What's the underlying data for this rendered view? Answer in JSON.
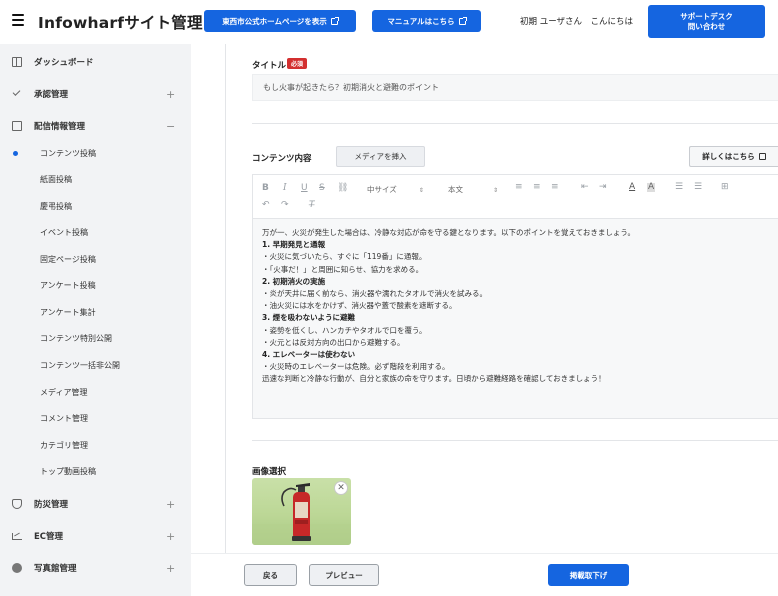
{
  "header": {
    "app_title": "Infowharfサイト管理",
    "city_site_button": "東西市公式ホームページを表示",
    "manual_button": "マニュアルはこちら",
    "greeting": "初期 ユーザさん　こんにちは",
    "support_button_line1": "サポートデスク",
    "support_button_line2": "問い合わせ"
  },
  "sidebar": {
    "items": [
      {
        "label": "ダッシュボード",
        "icon": "dashboard-icon"
      },
      {
        "label": "承認管理",
        "icon": "check-icon",
        "toggle": "+"
      },
      {
        "label": "配信情報管理",
        "icon": "edit-icon",
        "toggle": "−"
      }
    ],
    "subitems": [
      "コンテンツ投稿",
      "紙面投稿",
      "慶弔投稿",
      "イベント投稿",
      "固定ページ投稿",
      "アンケート投稿",
      "アンケート集計",
      "コンテンツ特別公開",
      "コンテンツ一括非公開",
      "メディア管理",
      "コメント管理",
      "カテゴリ管理",
      "トップ動画投稿"
    ],
    "active_subitem": "コンテンツ投稿",
    "bottom_items": [
      {
        "label": "防災管理",
        "icon": "shield-icon",
        "toggle": "+"
      },
      {
        "label": "EC管理",
        "icon": "chart-icon",
        "toggle": "+"
      },
      {
        "label": "写真館管理",
        "icon": "photo-icon",
        "toggle": "+"
      }
    ]
  },
  "form": {
    "title_label": "タイトル",
    "required_badge": "必須",
    "title_value": "もし火事が起きたら？初期消火と避難のポイント",
    "content_label": "コンテンツ内容",
    "insert_media_button": "メディアを挿入",
    "details_button": "詳しくはこちら",
    "toolbar": {
      "font_size_select": "中サイズ",
      "paragraph_select": "本文"
    },
    "content_lines": [
      {
        "text": "万が一、火災が発生した場合は、冷静な対応が命を守る鍵となります。以下のポイントを覚えておきましょう。",
        "heading": false
      },
      {
        "text": "1. 早期発見と通報",
        "heading": true
      },
      {
        "text": "・火災に気づいたら、すぐに「119番」に通報。",
        "heading": false
      },
      {
        "text": "・「火事だ！」と周囲に知らせ、協力を求める。",
        "heading": false
      },
      {
        "text": "2. 初期消火の実施",
        "heading": true
      },
      {
        "text": "・炎が天井に届く前なら、消火器や濡れたタオルで消火を試みる。",
        "heading": false
      },
      {
        "text": "・油火災には水をかけず、消火器や蓋で酸素を遮断する。",
        "heading": false
      },
      {
        "text": "3. 煙を吸わないように避難",
        "heading": true
      },
      {
        "text": "・姿勢を低くし、ハンカチやタオルで口を覆う。",
        "heading": false
      },
      {
        "text": "・火元とは反対方向の出口から避難する。",
        "heading": false
      },
      {
        "text": "4. エレベーターは使わない",
        "heading": true
      },
      {
        "text": "・火災時のエレベーターは危険。必ず階段を利用する。",
        "heading": false
      },
      {
        "text": "迅速な判断と冷静な行動が、自分と家族の命を守ります。日頃から避難経路を確認しておきましょう！",
        "heading": false
      }
    ],
    "image_label": "画像選択",
    "image_subject": "fire-extinguisher-photo"
  },
  "footer": {
    "back_button": "戻る",
    "preview_button": "プレビュー",
    "unpublish_button": "掲載取下げ"
  },
  "colors": {
    "accent": "#1565e0",
    "required": "#d32f2f",
    "sidebar_bg": "#f2f3f5"
  }
}
